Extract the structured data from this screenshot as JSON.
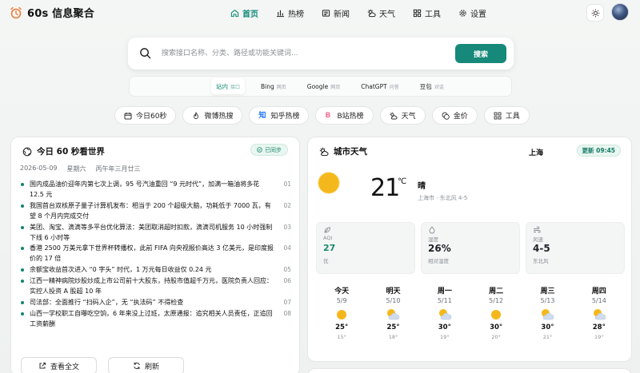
{
  "brand": {
    "name": "60s 信息聚合"
  },
  "nav": [
    {
      "label": "首页",
      "icon": "home-icon",
      "active": true
    },
    {
      "label": "热榜",
      "icon": "bar-chart-icon",
      "active": false
    },
    {
      "label": "新闻",
      "icon": "newspaper-icon",
      "active": false
    },
    {
      "label": "天气",
      "icon": "weather-icon",
      "active": false
    },
    {
      "label": "工具",
      "icon": "grid-icon",
      "active": false
    },
    {
      "label": "设置",
      "icon": "gear-icon",
      "active": false
    }
  ],
  "search": {
    "placeholder": "搜索接口名称、分类、路径或功能关键词...",
    "button": "搜索"
  },
  "engines": [
    {
      "label": "站内",
      "hint": "接口",
      "active": true
    },
    {
      "label": "Bing",
      "hint": "网页",
      "active": false
    },
    {
      "label": "Google",
      "hint": "网页",
      "active": false
    },
    {
      "label": "ChatGPT",
      "hint": "问答",
      "active": false
    },
    {
      "label": "豆包",
      "hint": "对话",
      "active": false
    }
  ],
  "chips": [
    {
      "label": "今日60秒",
      "icon": "calendar-icon"
    },
    {
      "label": "微博热搜",
      "icon": "flame-icon"
    },
    {
      "label": "知乎热榜",
      "icon": "zhihu-icon"
    },
    {
      "label": "B站热榜",
      "icon": "bilibili-icon"
    },
    {
      "label": "天气",
      "icon": "weather-icon"
    },
    {
      "label": "金价",
      "icon": "coin-icon"
    },
    {
      "label": "工具",
      "icon": "grid-icon"
    }
  ],
  "news": {
    "title": "今日 60 秒看世界",
    "badge": "已同步",
    "date": "2026-05-09",
    "weekday": "星期六",
    "lunar": "丙午年三月廿三",
    "items": [
      {
        "text": "国内成品油价迎年内第七次上调，95 号汽油重回 “9 元时代”，加满一箱油将多花 12.5 元",
        "num": "01"
      },
      {
        "text": "我国首台双核原子量子计算机发布：相当于 200 个超级大脑，功耗低于 7000 瓦，有望 8 个月内完成交付",
        "num": "02"
      },
      {
        "text": "美团、淘宝、滴滴等多平台优化算法：美团取消超时扣款，滴滴司机服务 10 小时强制下线 6 小时等",
        "num": "03"
      },
      {
        "text": "香港 2500 万美元拿下世界杯转播权，此前 FIFA 向央视报价高达 3 亿美元，是印度报价的 17 倍",
        "num": "04"
      },
      {
        "text": "余额宝收益首次进入 “0 字头” 时代，1 万元每日收益仅 0.24 元",
        "num": "05"
      },
      {
        "text": "江西一精神病院炒股炒成上市公司前十大股东，持股市值超千万元，医院负责人回应：实控人投资 A 股超 10 年",
        "num": "06"
      },
      {
        "text": "司法部：全面推行 “扫码入企”，无 “执法码” 不得检查",
        "num": "07"
      },
      {
        "text": "山西一学校职工自曝吃空饷，6 年来没上过班，太原通报：追究相关人员责任，正追回工资薪酬",
        "num": "08"
      }
    ],
    "actions": {
      "read_all": "查看全文",
      "refresh": "刷新"
    }
  },
  "weather": {
    "title": "城市天气",
    "city": "上海",
    "update": "更新 09:45",
    "temp": "21",
    "unit": "℃",
    "condition": "晴",
    "sub": "上海市 · 东北风 4-5",
    "stats": [
      {
        "label": "AQI",
        "value": "27",
        "sub": "优",
        "icon": "leaf-icon",
        "highlight": true
      },
      {
        "label": "湿度",
        "value": "26%",
        "sub": "相对湿度",
        "icon": "droplet-icon",
        "highlight": false
      },
      {
        "label": "风速",
        "value": "4-5",
        "sub": "东北风",
        "icon": "wind-icon",
        "highlight": false
      }
    ],
    "forecast": [
      {
        "day": "今天",
        "date": "5/9",
        "icon": "sun-icon",
        "high": "25°",
        "low": "15°"
      },
      {
        "day": "明天",
        "date": "5/10",
        "icon": "partly-cloudy-icon",
        "high": "25°",
        "low": "18°"
      },
      {
        "day": "周一",
        "date": "5/11",
        "icon": "partly-cloudy-icon",
        "high": "30°",
        "low": "19°"
      },
      {
        "day": "周二",
        "date": "5/12",
        "icon": "sun-icon",
        "high": "30°",
        "low": "20°"
      },
      {
        "day": "周三",
        "date": "5/13",
        "icon": "partly-cloudy-icon",
        "high": "30°",
        "low": "21°"
      },
      {
        "day": "周四",
        "date": "5/14",
        "icon": "partly-cloudy-icon",
        "high": "28°",
        "low": "19°"
      }
    ]
  },
  "colors": {
    "accent": "#17897a",
    "sun": "#f5b81c"
  }
}
